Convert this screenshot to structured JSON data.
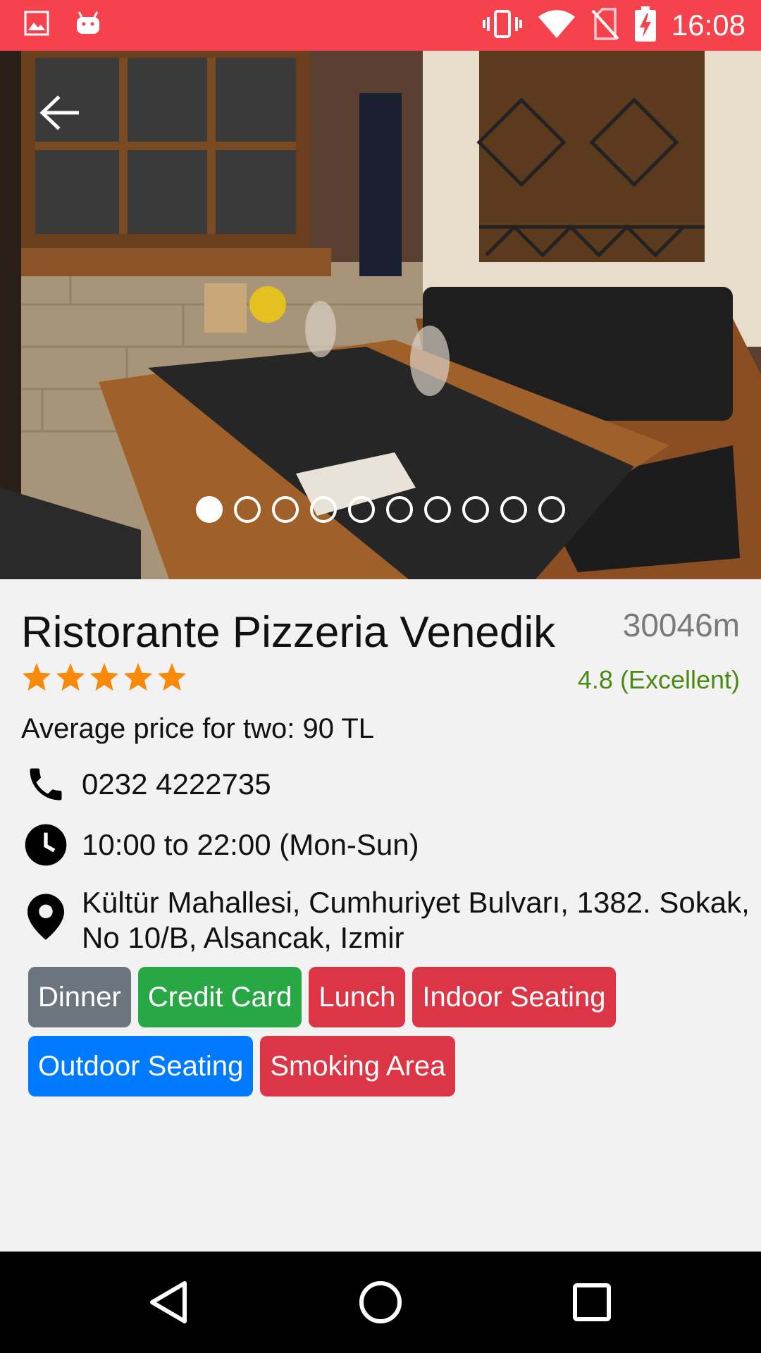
{
  "status_bar": {
    "time": "16:08",
    "icons": [
      "image-icon",
      "android-icon",
      "vibrate-icon",
      "wifi-icon",
      "no-sim-icon",
      "battery-charging-icon"
    ],
    "background": "#f5424c"
  },
  "gallery": {
    "photo_count": 10,
    "active_index": 0,
    "back_icon": "arrow-back-icon"
  },
  "restaurant": {
    "name": "Ristorante Pizzeria Venedik",
    "distance": "30046m",
    "stars": 5,
    "rating_text": "4.8 (Excellent)",
    "average_price": "Average price for two: 90 TL",
    "phone": "0232 4222735",
    "hours": "10:00 to 22:00 (Mon-Sun)",
    "address_line1": "Kültür Mahallesi, Cumhuriyet Bulvarı, 1382. Sokak,",
    "address_line2": "No 10/B, Alsancak, Izmir"
  },
  "tags": [
    {
      "label": "Dinner",
      "color": "#6c757d"
    },
    {
      "label": "Credit Card",
      "color": "#28a745"
    },
    {
      "label": "Lunch",
      "color": "#dc3545"
    },
    {
      "label": "Indoor Seating",
      "color": "#dc3545"
    },
    {
      "label": "Outdoor Seating",
      "color": "#007bff"
    },
    {
      "label": "Smoking Area",
      "color": "#dc3545"
    }
  ],
  "colors": {
    "star": "#f78a0a",
    "rating": "#4a8a12"
  },
  "nav_bar": {
    "icons": [
      "back-triangle-icon",
      "home-circle-icon",
      "recents-square-icon"
    ]
  }
}
